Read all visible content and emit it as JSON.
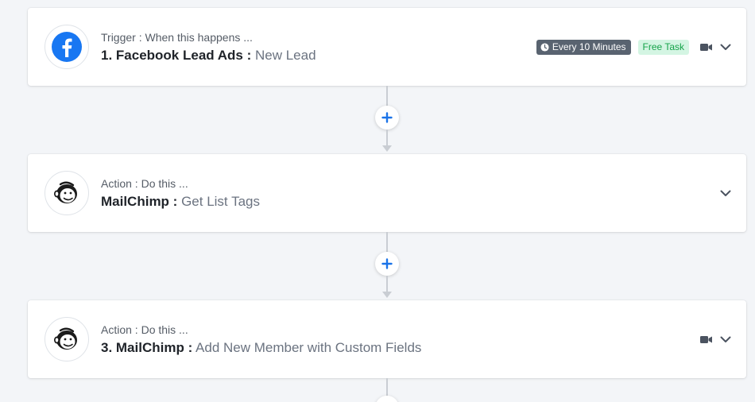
{
  "steps": [
    {
      "kind": "Trigger : When this happens ...",
      "app": "1. Facebook Lead Ads :",
      "event": "New Lead",
      "icon": "facebook-icon",
      "schedule_label": "Every 10 Minutes",
      "free_label": "Free Task"
    },
    {
      "kind": "Action : Do this ...",
      "app": "MailChimp :",
      "event": "Get List Tags",
      "icon": "mailchimp-icon"
    },
    {
      "kind": "Action : Do this ...",
      "app": "3. MailChimp :",
      "event": "Add New Member with Custom Fields",
      "icon": "mailchimp-icon"
    }
  ],
  "colors": {
    "accent": "#1a73e8",
    "facebook": "#1877f2",
    "free_badge_bg": "#d4f5e3",
    "free_badge_text": "#16a34a",
    "schedule_badge_bg": "#596370"
  }
}
